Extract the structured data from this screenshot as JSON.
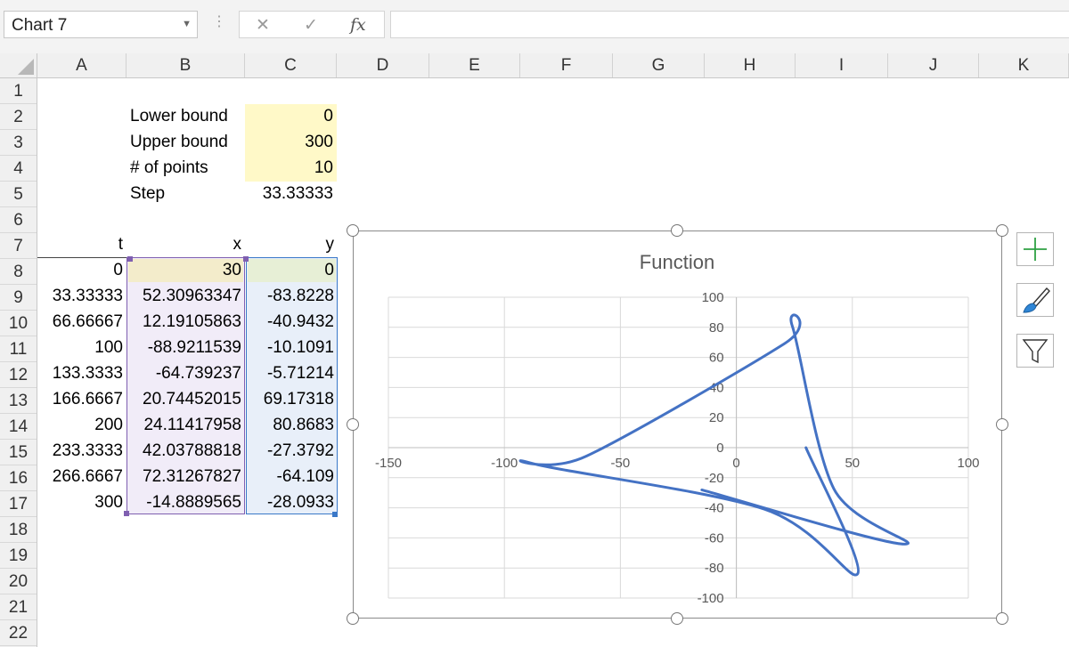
{
  "formula_bar": {
    "name_box": "Chart 7",
    "cancel_icon": "close-icon",
    "enter_icon": "checkmark-icon",
    "fx_label": "fx",
    "formula": ""
  },
  "columns": [
    "A",
    "B",
    "C",
    "D",
    "E",
    "F",
    "G",
    "H",
    "I",
    "J",
    "K"
  ],
  "rows": [
    "1",
    "2",
    "3",
    "4",
    "5",
    "6",
    "7",
    "8",
    "9",
    "10",
    "11",
    "12",
    "13",
    "14",
    "15",
    "16",
    "17",
    "18",
    "19",
    "20",
    "21",
    "22"
  ],
  "params": {
    "lower_label": "Lower bound",
    "lower_value": "0",
    "upper_label": "Upper bound",
    "upper_value": "300",
    "points_label": "# of points",
    "points_value": "10",
    "step_label": "Step",
    "step_value": "33.33333"
  },
  "table": {
    "headers": [
      "t",
      "x",
      "y"
    ],
    "rows": [
      [
        "0",
        "30",
        "0"
      ],
      [
        "33.33333",
        "52.30963347",
        "-83.8228"
      ],
      [
        "66.66667",
        "12.19105863",
        "-40.9432"
      ],
      [
        "100",
        "-88.9211539",
        "-10.1091"
      ],
      [
        "133.3333",
        "-64.739237",
        "-5.71214"
      ],
      [
        "166.6667",
        "20.74452015",
        "69.17318"
      ],
      [
        "200",
        "24.11417958",
        "80.8683"
      ],
      [
        "233.3333",
        "42.03788818",
        "-27.3792"
      ],
      [
        "266.6667",
        "72.31267827",
        "-64.109"
      ],
      [
        "300",
        "-14.8889565",
        "-28.0933"
      ]
    ]
  },
  "chart_data": {
    "type": "scatter",
    "title": "Function",
    "smooth": true,
    "xlim": [
      -150,
      100
    ],
    "ylim": [
      -100,
      100
    ],
    "x_ticks": [
      "-150",
      "-100",
      "-50",
      "0",
      "50",
      "100"
    ],
    "y_ticks": [
      "100",
      "80",
      "60",
      "40",
      "20",
      "0",
      "-20",
      "-40",
      "-60",
      "-80",
      "-100"
    ],
    "grid": true,
    "series": [
      {
        "x": [
          30,
          52.30963347,
          12.19105863,
          -88.9211539,
          -64.739237,
          20.74452015,
          24.11417958,
          42.03788818,
          72.31267827,
          -14.8889565
        ],
        "y": [
          0,
          -83.8228,
          -40.9432,
          -10.1091,
          -5.71214,
          69.17318,
          80.8683,
          -27.3792,
          -64.109,
          -28.0933
        ],
        "color": "#4472c4"
      }
    ]
  },
  "chart_tools": {
    "add_icon": "plus-icon",
    "style_icon": "paintbrush-icon",
    "filter_icon": "filter-icon"
  },
  "colors": {
    "input_fill": "#fff9c8",
    "x_range": "#7f5fb0",
    "y_range": "#3a78c8",
    "series": "#4472c4"
  }
}
